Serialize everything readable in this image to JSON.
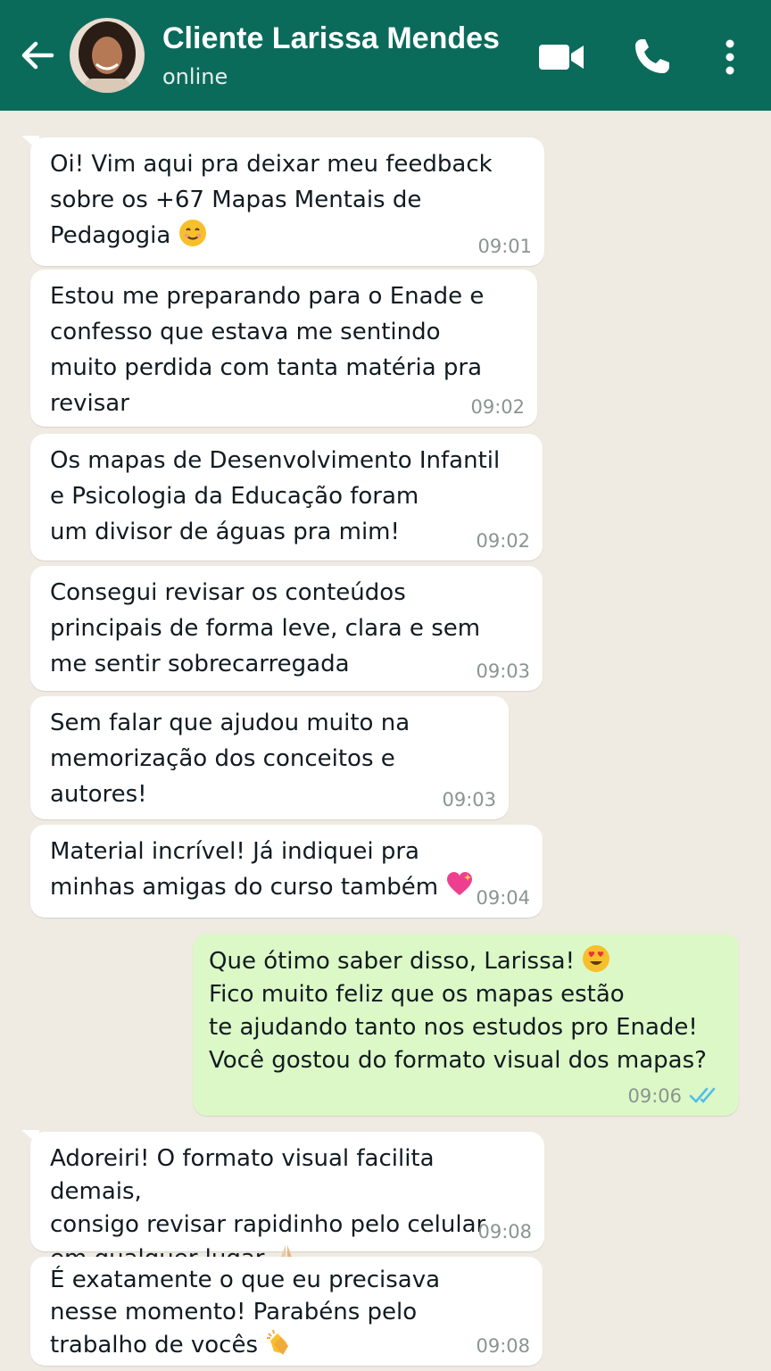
{
  "header": {
    "contact_name": "Cliente Larissa Mendes",
    "status": "online",
    "background_color": "#0b6b5b"
  },
  "messages": [
    {
      "direction": "in",
      "lines": [
        "Oi! Vim aqui pra deixar meu feedback",
        "sobre os +67 Mapas Mentais de",
        "Pedagogia"
      ],
      "emoji": "smiling-face",
      "time": "09:01"
    },
    {
      "direction": "in",
      "lines": [
        "Estou me preparando para o Enade e",
        "confesso que estava me sentindo",
        "muito perdida com tanta matéria pra",
        "revisar"
      ],
      "time": "09:02"
    },
    {
      "direction": "in",
      "lines": [
        "Os mapas de Desenvolvimento Infantil",
        "e Psicologia da Educação foram",
        "um divisor de águas pra mim!"
      ],
      "time": "09:02"
    },
    {
      "direction": "in",
      "lines": [
        "Consegui revisar os conteúdos",
        "principais de forma leve, clara e sem",
        "me sentir sobrecarregada"
      ],
      "time": "09:03"
    },
    {
      "direction": "in",
      "lines": [
        "Sem falar que ajudou muito na",
        "memorização dos conceitos e",
        "autores!"
      ],
      "time": "09:03"
    },
    {
      "direction": "in",
      "lines": [
        "Material incrível! Já indiquei pra",
        "minhas amigas do curso também"
      ],
      "emoji": "sparkling-heart",
      "time": "09:04"
    },
    {
      "direction": "out",
      "lines": [
        "Que ótimo saber disso, Larissa!",
        "Fico muito feliz que os mapas estão",
        "te ajudando tanto nos estudos pro Enade!",
        "Você gostou do formato visual dos mapas?"
      ],
      "emoji": "heart-eyes",
      "time": "09:06",
      "status": "read"
    },
    {
      "direction": "in",
      "lines": [
        "Adoreiri! O formato visual facilita demais,",
        "consigo revisar rapidinho pelo celular",
        "em qualquer lugar"
      ],
      "emoji": "folded-hands",
      "time": "09:08"
    },
    {
      "direction": "in",
      "lines": [
        "É exatamente o que eu precisava",
        "nesse momento! Parabéns pelo",
        "trabalho de vocês"
      ],
      "emoji": "clapping-hands",
      "time": "09:08"
    }
  ],
  "colors": {
    "chat_background": "#efeae2",
    "incoming_bubble": "#ffffff",
    "outgoing_bubble": "#dcf8c6",
    "read_ticks": "#53bdeb"
  }
}
